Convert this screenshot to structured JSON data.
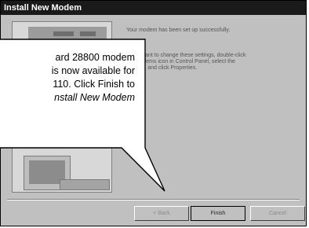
{
  "window": {
    "title": "Install New Modem"
  },
  "wizard": {
    "success_text": "Your modem has been set up successfully.",
    "hint_text": "If you want to change these settings, double-click the Modems icon in Control Panel, select the modem, and click Properties."
  },
  "buttons": {
    "back": "< Back",
    "finish": "Finish",
    "cancel": "Cancel"
  },
  "callout": {
    "line1": "ard 28800 modem",
    "line2": "is now available for",
    "line3": "110. Click Finish to",
    "line4": "nstall New Modem"
  },
  "colors": {
    "titlebar": "#1a1a1a",
    "dialog_face": "#c0c0c0",
    "callout_fill": "#ffffff"
  }
}
